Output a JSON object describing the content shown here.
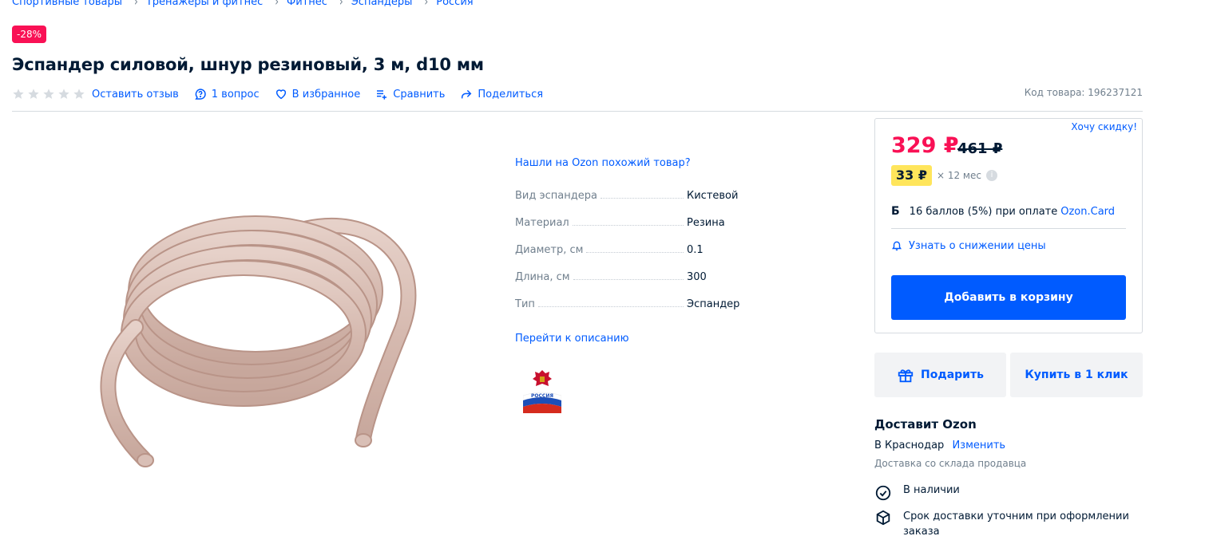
{
  "breadcrumbs": [
    "Спортивные товары",
    "Тренажеры и фитнес",
    "Фитнес",
    "Эспандеры",
    "Россия"
  ],
  "discount_badge": "-28%",
  "title": "Эспандер силовой, шнур резиновый, 3 м, d10 мм",
  "rating": {
    "stars": 0,
    "max": 5
  },
  "actions": {
    "review": "Оставить отзыв",
    "questions": "1 вопрос",
    "favorite": "В избранное",
    "compare": "Сравнить",
    "share": "Поделиться"
  },
  "sku": "Код товара: 196237121",
  "similar_link": "Нашли на Ozon похожий товар?",
  "specs": [
    {
      "key": "Вид эспандера",
      "value": "Кистевой"
    },
    {
      "key": "Материал",
      "value": "Резина"
    },
    {
      "key": "Диаметр, см",
      "value": "0.1"
    },
    {
      "key": "Длина, см",
      "value": "300"
    },
    {
      "key": "Тип",
      "value": "Эспандер"
    }
  ],
  "description_link": "Перейти к описанию",
  "origin_badge_text": "РОССИЯ",
  "price": {
    "want_discount": "Хочу скидку!",
    "current": "329 ₽",
    "old": "461 ₽",
    "installment_price": "33 ₽",
    "installment_term": "× 12 мес",
    "bonus_icon": "Б",
    "bonus_text": "16 баллов (5%) при оплате",
    "bonus_link": "Ozon.Card",
    "price_alert": "Узнать о снижении цены",
    "add_to_cart": "Добавить в корзину"
  },
  "buttons": {
    "gift": "Подарить",
    "one_click": "Купить в 1 клик"
  },
  "delivery": {
    "title": "Доставит Ozon",
    "city": "В Краснодар",
    "change": "Изменить",
    "source": "Доставка со склада продавца",
    "in_stock": "В наличии",
    "term": "Срок доставки уточним при оформлении заказа"
  },
  "colors": {
    "accent": "#005bff",
    "sale": "#f91155",
    "installment": "#ffe55b",
    "product": "#d9bfb6"
  },
  "icons": [
    "star-icon",
    "question-icon",
    "heart-icon",
    "compare-icon",
    "share-icon",
    "info-icon",
    "bell-icon",
    "gift-icon",
    "check-circle-icon",
    "box-icon"
  ]
}
